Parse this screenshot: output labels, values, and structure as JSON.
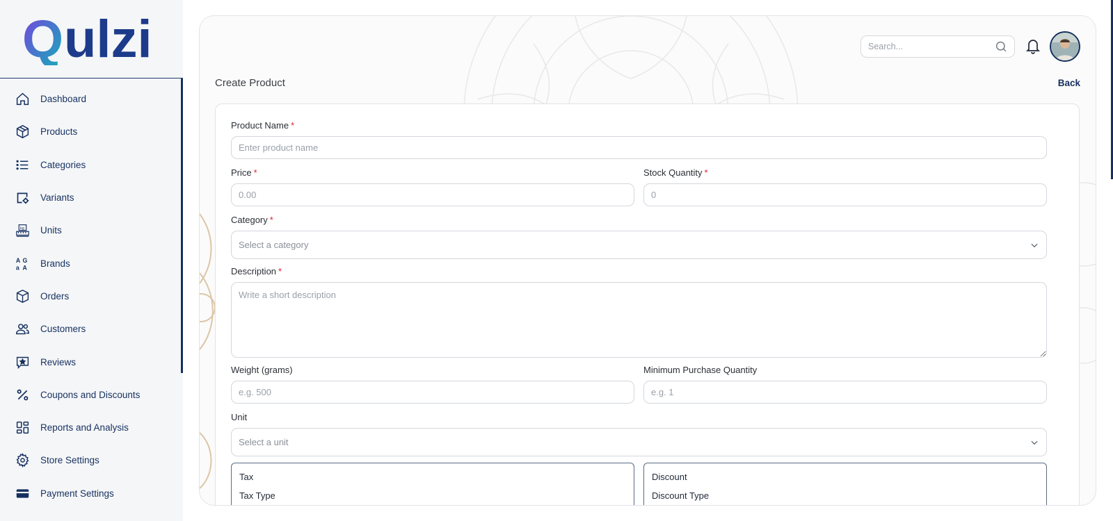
{
  "brand": {
    "name": "Qulzi"
  },
  "sidebar": {
    "items": [
      {
        "label": "Dashboard",
        "icon": "home-icon"
      },
      {
        "label": "Products",
        "icon": "box-icon"
      },
      {
        "label": "Categories",
        "icon": "list-icon"
      },
      {
        "label": "Variants",
        "icon": "variants-icon"
      },
      {
        "label": "Units",
        "icon": "scale-icon"
      },
      {
        "label": "Brands",
        "icon": "brands-icon"
      },
      {
        "label": "Orders",
        "icon": "package-icon"
      },
      {
        "label": "Customers",
        "icon": "users-icon"
      },
      {
        "label": "Reviews",
        "icon": "star-message-icon"
      },
      {
        "label": "Coupons and Discounts",
        "icon": "percent-icon"
      },
      {
        "label": "Reports and Analysis",
        "icon": "grid-icon"
      },
      {
        "label": "Store Settings",
        "icon": "gear-icon"
      },
      {
        "label": "Payment Settings",
        "icon": "card-icon"
      }
    ]
  },
  "header": {
    "search_placeholder": "Search...",
    "search_value": ""
  },
  "page": {
    "title": "Create Product",
    "back_label": "Back"
  },
  "form": {
    "product_name": {
      "label": "Product Name",
      "required": "*",
      "placeholder": "Enter product name",
      "value": ""
    },
    "price": {
      "label": "Price",
      "required": "*",
      "placeholder": "0.00",
      "value": ""
    },
    "stock": {
      "label": "Stock Quantity",
      "required": "*",
      "placeholder": "0",
      "value": ""
    },
    "category": {
      "label": "Category",
      "required": "*",
      "selected": "Select a category"
    },
    "description": {
      "label": "Description",
      "required": "*",
      "placeholder": "Write a short description",
      "value": ""
    },
    "weight": {
      "label": "Weight (grams)",
      "placeholder": "e.g. 500",
      "value": ""
    },
    "min_qty": {
      "label": "Minimum Purchase Quantity",
      "placeholder": "e.g. 1",
      "value": ""
    },
    "unit": {
      "label": "Unit",
      "selected": "Select a unit"
    },
    "tax": {
      "title": "Tax",
      "sub": "Tax Type"
    },
    "discount": {
      "title": "Discount",
      "sub": "Discount Type"
    }
  },
  "colors": {
    "navy": "#15305f",
    "required": "#e11d2e",
    "logo_start": "#6d3fd6",
    "logo_end": "#1aa7b8"
  }
}
